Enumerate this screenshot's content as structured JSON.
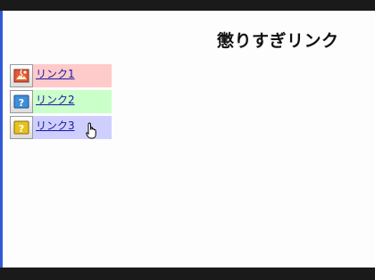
{
  "title": "懲りすぎリンク",
  "links": [
    {
      "label": "リンク1",
      "bg": "#ffcaca",
      "icon": "broken-image-icon",
      "icon_color": "#e2583a"
    },
    {
      "label": "リンク2",
      "bg": "#caffca",
      "icon": "help-question-icon",
      "icon_color": "#3d8fd9"
    },
    {
      "label": "リンク3",
      "bg": "#cfcfff",
      "icon": "help-question-yellow-icon",
      "icon_color": "#e8c21d"
    }
  ],
  "colors": {
    "frame": "#0b0b0b",
    "page": "#fdfdfd",
    "left_accent": "#2f59d6",
    "link_text": "#1a1aa6"
  }
}
